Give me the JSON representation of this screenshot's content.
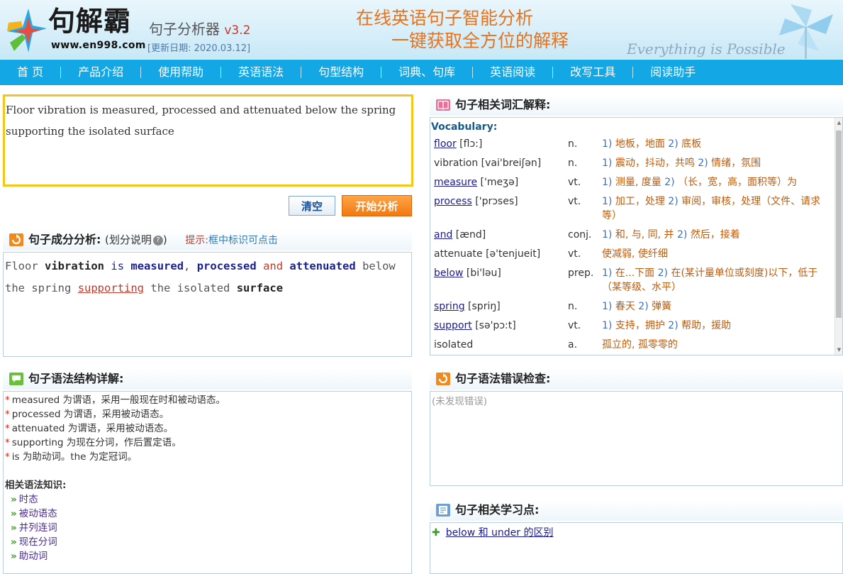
{
  "header": {
    "logo_text": "句解霸",
    "logo_url": "www.en998.com",
    "product_name": "句子分析器",
    "version": "v3.2",
    "update_date": "[更新日期: 2020.03.12]",
    "slogan_line1": "在线英语句子智能分析",
    "slogan_line2": "一键获取全方位的解释",
    "motto": "Everything is Possible"
  },
  "nav": {
    "items": [
      "首 页",
      "产品介绍",
      "使用帮助",
      "英语语法",
      "句型结构",
      "词典、句库",
      "英语阅读",
      "改写工具",
      "阅读助手"
    ]
  },
  "input": {
    "sentence": "Floor vibration is measured, processed and attenuated below the spring supporting the isolated surface"
  },
  "buttons": {
    "clear": "清空",
    "analyze": "开始分析"
  },
  "component": {
    "title": "句子成分分析:",
    "subtitle": "(划分说明",
    "subtitle_close": ")",
    "help_glyph": "?",
    "tip_label": "提示:",
    "tip_text": "框中标识可点击",
    "tokens": [
      "Floor",
      "vibration",
      "is",
      "measured",
      ",",
      "processed",
      "and",
      "attenuated",
      "below",
      "the",
      "spring",
      "supporting",
      "the",
      "isolated",
      "surface"
    ]
  },
  "vocab": {
    "title": "句子相关词汇解释:",
    "heading": "Vocabulary:",
    "entries": [
      {
        "word": "floor",
        "phon": "[flɔ:]",
        "pos": "n.",
        "defs": [
          [
            "1)",
            "地板，地面"
          ],
          [
            "2)",
            "底板"
          ]
        ]
      },
      {
        "word": "vibration",
        "phon": "[vai'breiʃən]",
        "pos": "n.",
        "defs": [
          [
            "1)",
            "震动，抖动，共鸣"
          ],
          [
            "2)",
            "情绪，氛围"
          ]
        ]
      },
      {
        "word": "measure",
        "phon": "['meʒə]",
        "pos": "vt.",
        "defs": [
          [
            "1)",
            "测量, 度量"
          ],
          [
            "2)",
            "（长，宽，高，面积等）为"
          ]
        ]
      },
      {
        "word": "process",
        "phon": "['prɔses]",
        "pos": "vt.",
        "defs": [
          [
            "1)",
            "加工，处理"
          ],
          [
            "2)",
            "审阅，审核，处理（文件、请求等）"
          ]
        ]
      },
      {
        "word": "and",
        "phon": "[ænd]",
        "pos": "conj.",
        "defs": [
          [
            "1)",
            "和, 与, 同, 并"
          ],
          [
            "2)",
            "然后，接着"
          ]
        ]
      },
      {
        "word": "attenuate",
        "phon": "[ə'tenjueit]",
        "pos": "vt.",
        "defs": [
          [
            "",
            "使减弱, 使纤细"
          ]
        ]
      },
      {
        "word": "below",
        "phon": "[bi'ləu]",
        "pos": "prep.",
        "defs": [
          [
            "1)",
            "在...下面"
          ],
          [
            "2)",
            "在(某计量单位或刻度)以下，低于（某等级、水平）"
          ]
        ]
      },
      {
        "word": "spring",
        "phon": "[spriŋ]",
        "pos": "n.",
        "defs": [
          [
            "1)",
            "春天"
          ],
          [
            "2)",
            "弹簧"
          ]
        ]
      },
      {
        "word": "support",
        "phon": "[sə'pɔ:t]",
        "pos": "vt.",
        "defs": [
          [
            "1)",
            "支持，拥护"
          ],
          [
            "2)",
            "帮助，援助"
          ]
        ]
      },
      {
        "word": "isolated",
        "phon": "",
        "pos": "a.",
        "defs": [
          [
            "",
            "孤立的, 孤零零的"
          ]
        ]
      }
    ]
  },
  "grammar": {
    "title": "句子语法结构详解:",
    "lines": [
      "measured 为谓语，采用一般现在时和被动语态。",
      "processed 为谓语，采用被动语态。",
      "attenuated 为谓语，采用被动语态。",
      "supporting 为现在分词，作后置定语。",
      "is 为助动词。the 为定冠词。"
    ],
    "knowledge_title": "相关语法知识:",
    "knowledge_links": [
      "时态",
      "被动语态",
      "并列连词",
      "现在分词",
      "助动词"
    ]
  },
  "error_check": {
    "title": "句子语法错误检查:",
    "result": "(未发现错误)"
  },
  "learning": {
    "title": "句子相关学习点:",
    "points": [
      "below 和 under 的区别"
    ]
  },
  "colors": {
    "nav_bg": "#14a7e6",
    "accent_orange": "#f07a10",
    "input_border": "#f5c518",
    "predicate": "#1a1f8f",
    "conjunction": "#c0392b"
  }
}
